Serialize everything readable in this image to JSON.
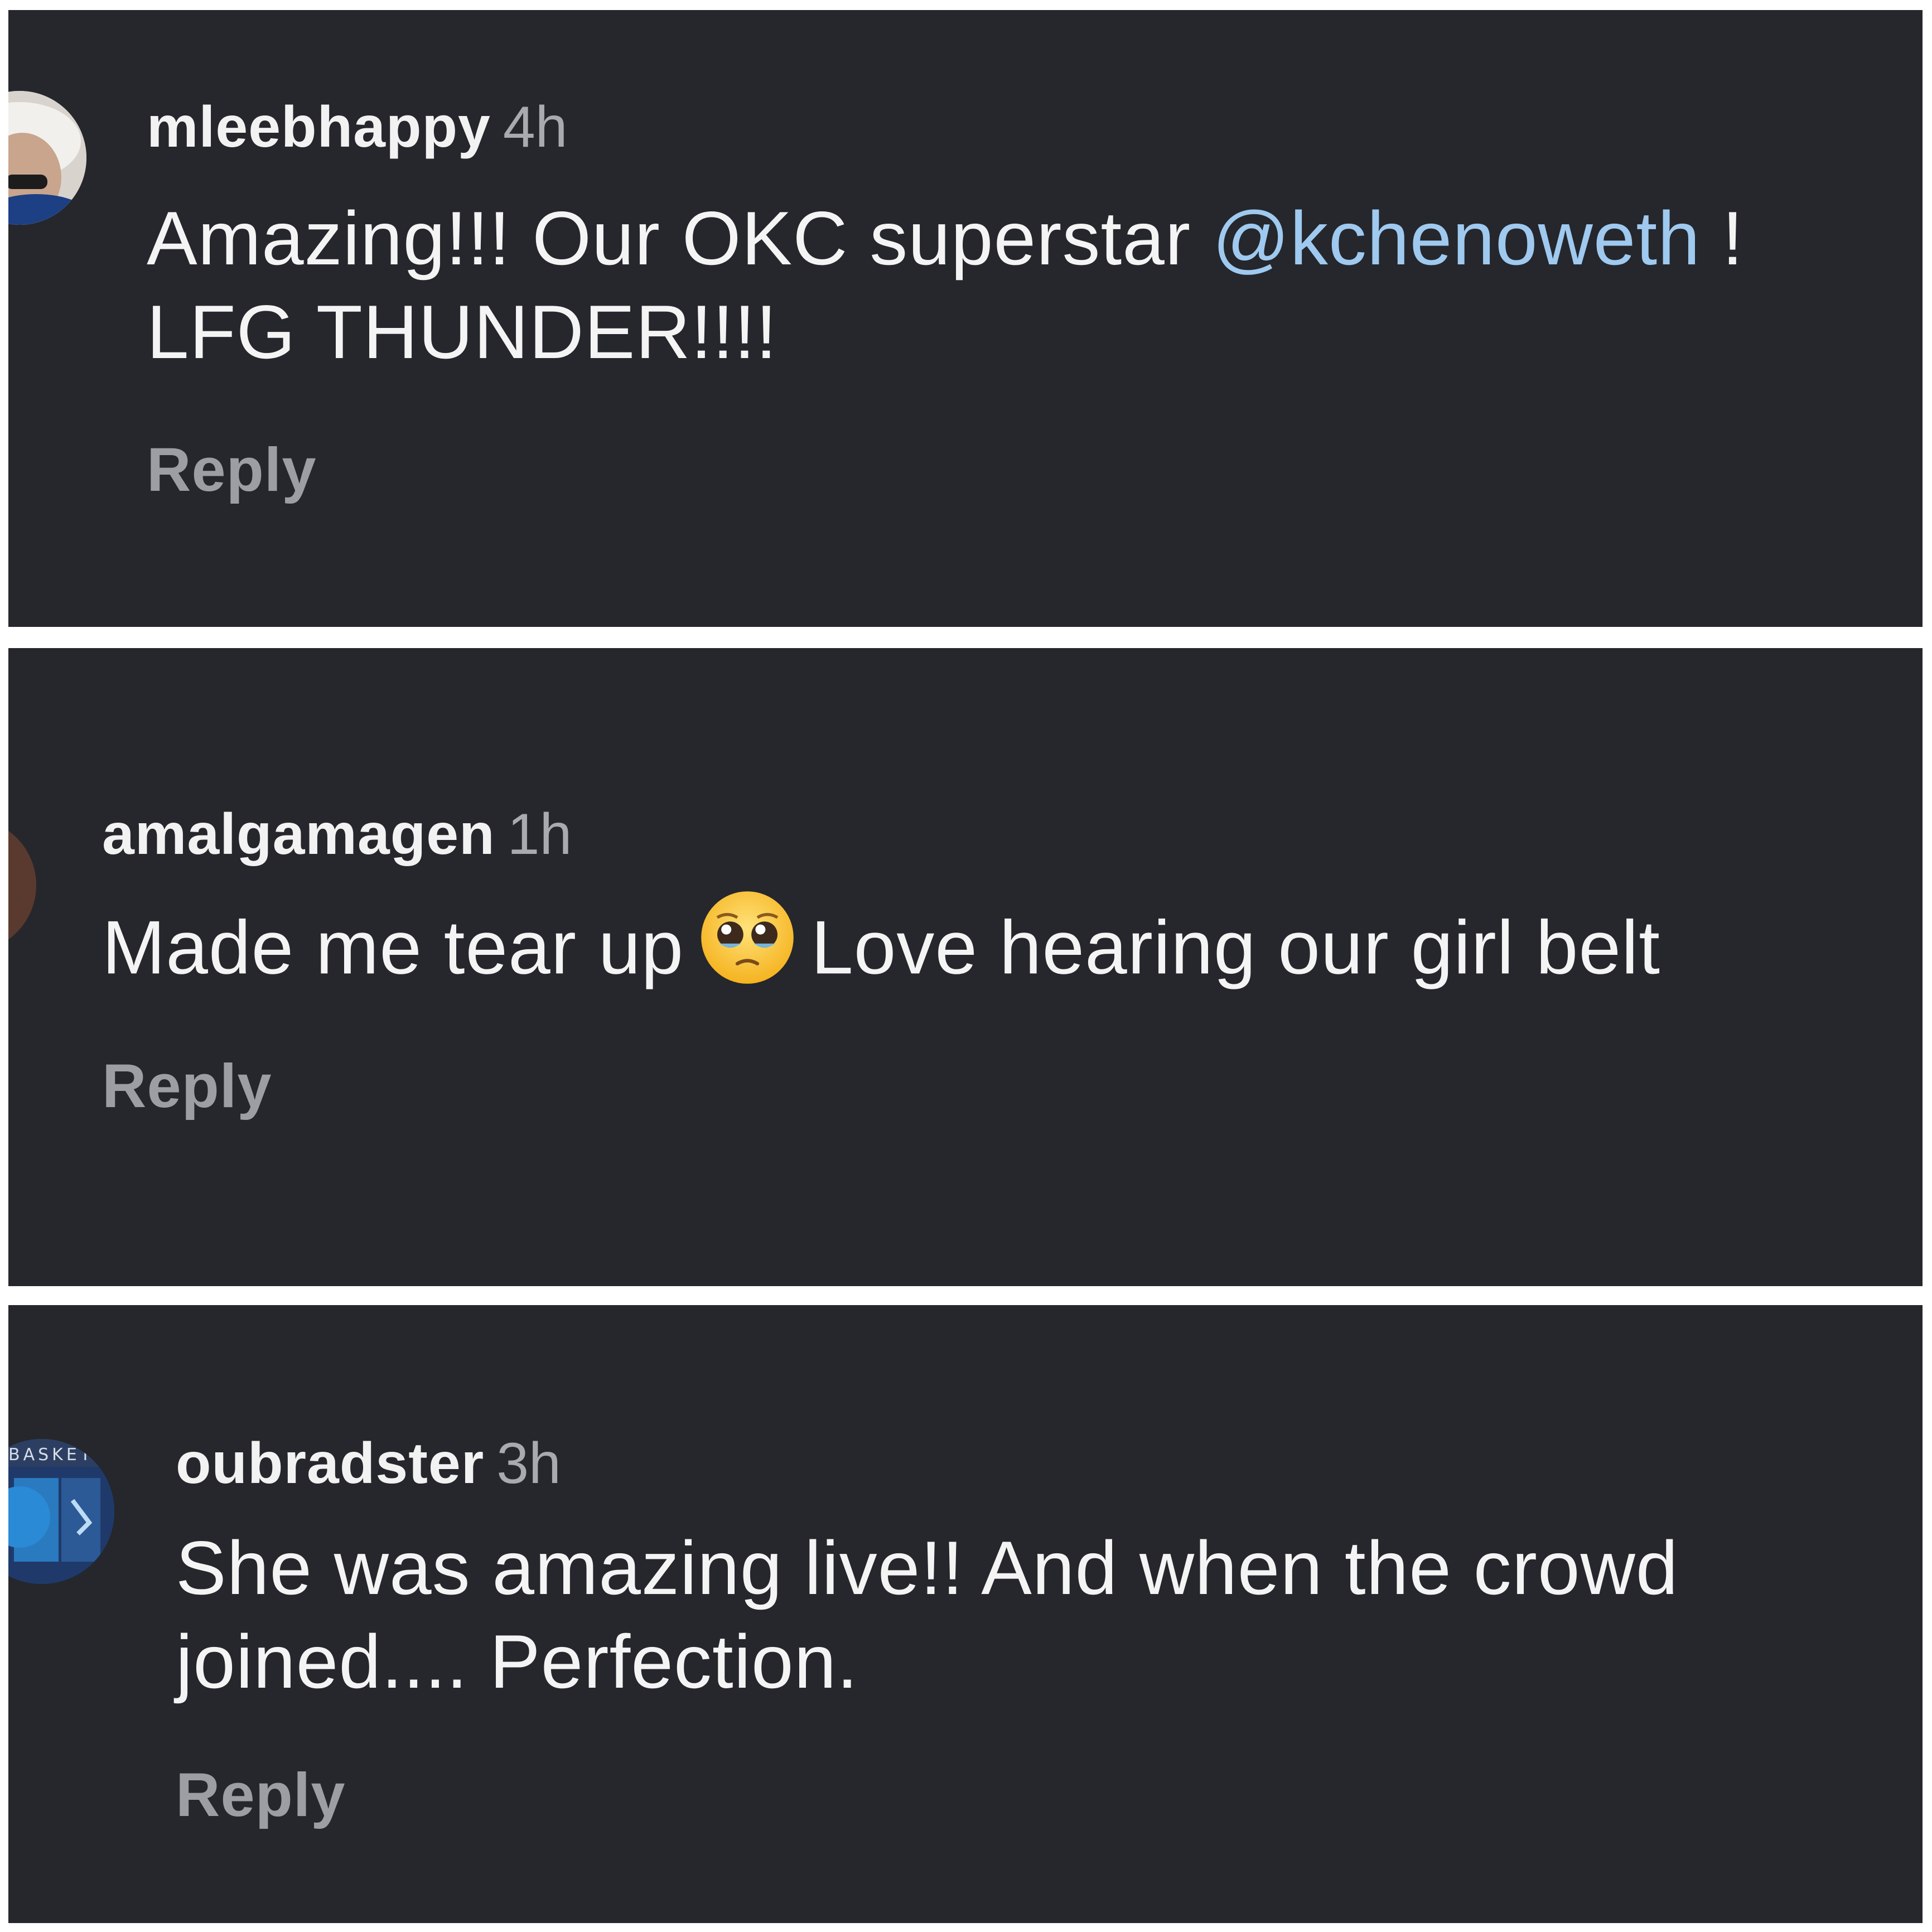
{
  "colors": {
    "panel_background": "#25272c",
    "username": "#f2f2f2",
    "timestamp": "#a8aaaf",
    "body_text": "#f4f4f4",
    "mention": "#9fc9ef",
    "reply": "#9c9ea3"
  },
  "comments": [
    {
      "username": "mleebhappy",
      "time": "4h",
      "text_before": "Amazing!!! Our OKC superstar ",
      "mention": "@kchenoweth",
      "text_after": " ! LFG THUNDER!!!!",
      "reply_label": "Reply"
    },
    {
      "username": "amalgamagen",
      "time": "1h",
      "text_before": "Made me tear up",
      "emoji": "pleading-face-emoji",
      "text_after": "Love hearing our girl belt",
      "reply_label": "Reply"
    },
    {
      "username": "oubradster",
      "time": "3h",
      "text": "She was amazing live!! And when the crowd joined.... Perfection.",
      "avatar_text": "BASKET",
      "reply_label": "Reply"
    }
  ]
}
